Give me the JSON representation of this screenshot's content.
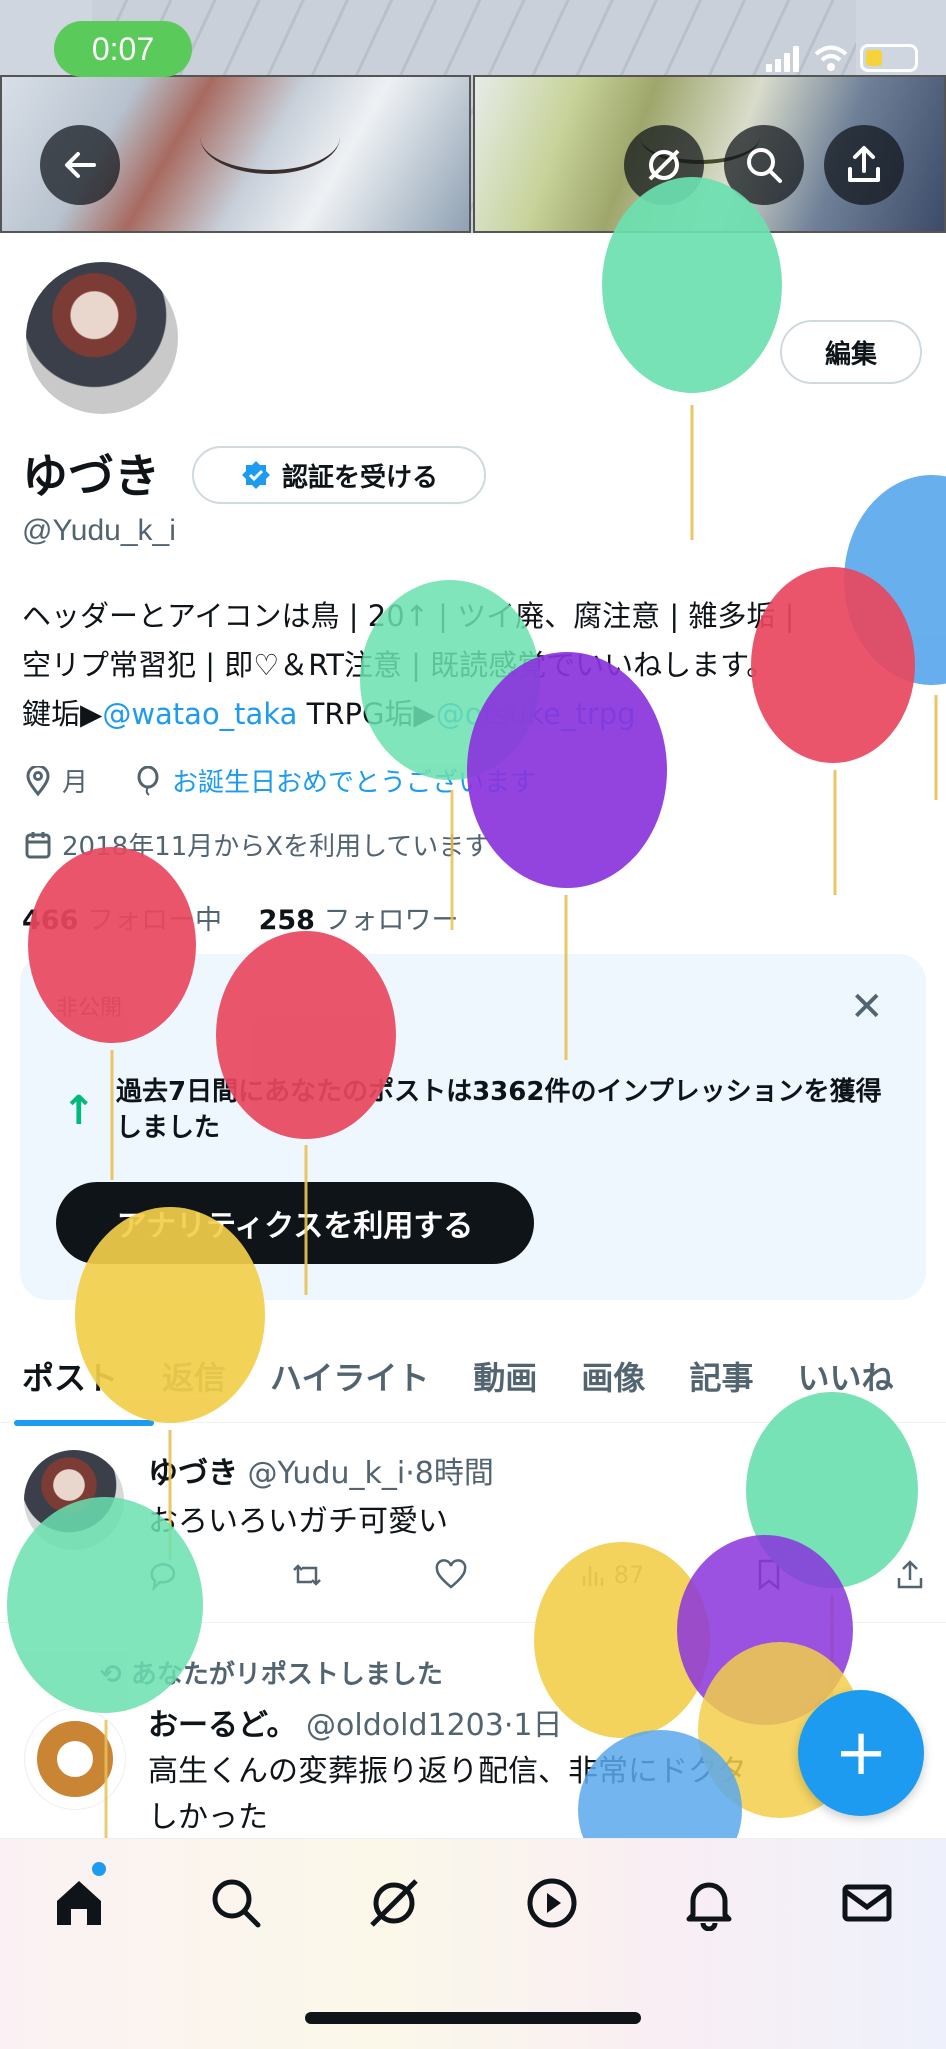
{
  "status_bar": {
    "time": "0:07"
  },
  "profile": {
    "name": "ゆづき",
    "verify_label": "認証を受ける",
    "handle": "@Yudu_k_i",
    "edit_label": "編集",
    "bio_line1": "ヘッダーとアイコンは鳥 | 20↑ | ツイ廃、腐注意 | 雑多垢 |",
    "bio_line2": "空リプ常習犯 | 即♡＆RT注意 | 既読感覚でいいねします。",
    "bio_line3_prefix": "鍵垢▶",
    "bio_link1": "@watao_taka",
    "bio_line3_mid": " TRPG垢▶",
    "bio_link2": "@otsuke_trpg",
    "location": "月",
    "birthday": "お誕生日おめでとうございます",
    "joined": "2018年11月からXを利用しています",
    "following_count": "466",
    "following_label": "フォロー中",
    "followers_count": "258",
    "followers_label": "フォロワー"
  },
  "analytics_card": {
    "private_label": "非公開",
    "text": "過去7日間にあなたのポストは3362件のインプレッションを獲得しました",
    "button_label": "アナリティクスを利用する"
  },
  "tabs": [
    "ポスト",
    "返信",
    "ハイライト",
    "動画",
    "画像",
    "記事",
    "いいね"
  ],
  "posts": [
    {
      "name": "ゆづき",
      "handle": "@Yudu_k_i",
      "time": "8時間",
      "text": "おろいろいガチ可愛い",
      "views": "87"
    },
    {
      "repost_note": "あなたがリポストしました",
      "name": "おーるど。",
      "handle": "@oldold1203",
      "time": "1日",
      "text_line1": "高生くんの変葬振り返り配信、非常にドクタ",
      "text_line2": "しかった"
    }
  ],
  "colors": {
    "accent": "#1d9bf0",
    "text": "#0f1419",
    "muted": "#536471",
    "card_bg": "#eef7fe"
  },
  "icons": [
    "back-arrow-icon",
    "grok-icon",
    "search-icon",
    "share-icon",
    "verified-badge-icon",
    "location-icon",
    "balloon-icon",
    "calendar-icon",
    "close-icon",
    "arrow-up-icon",
    "reply-icon",
    "repost-icon",
    "like-icon",
    "views-icon",
    "bookmark-icon",
    "home-icon",
    "explore-icon",
    "video-icon",
    "bell-icon",
    "mail-icon",
    "plus-icon"
  ]
}
